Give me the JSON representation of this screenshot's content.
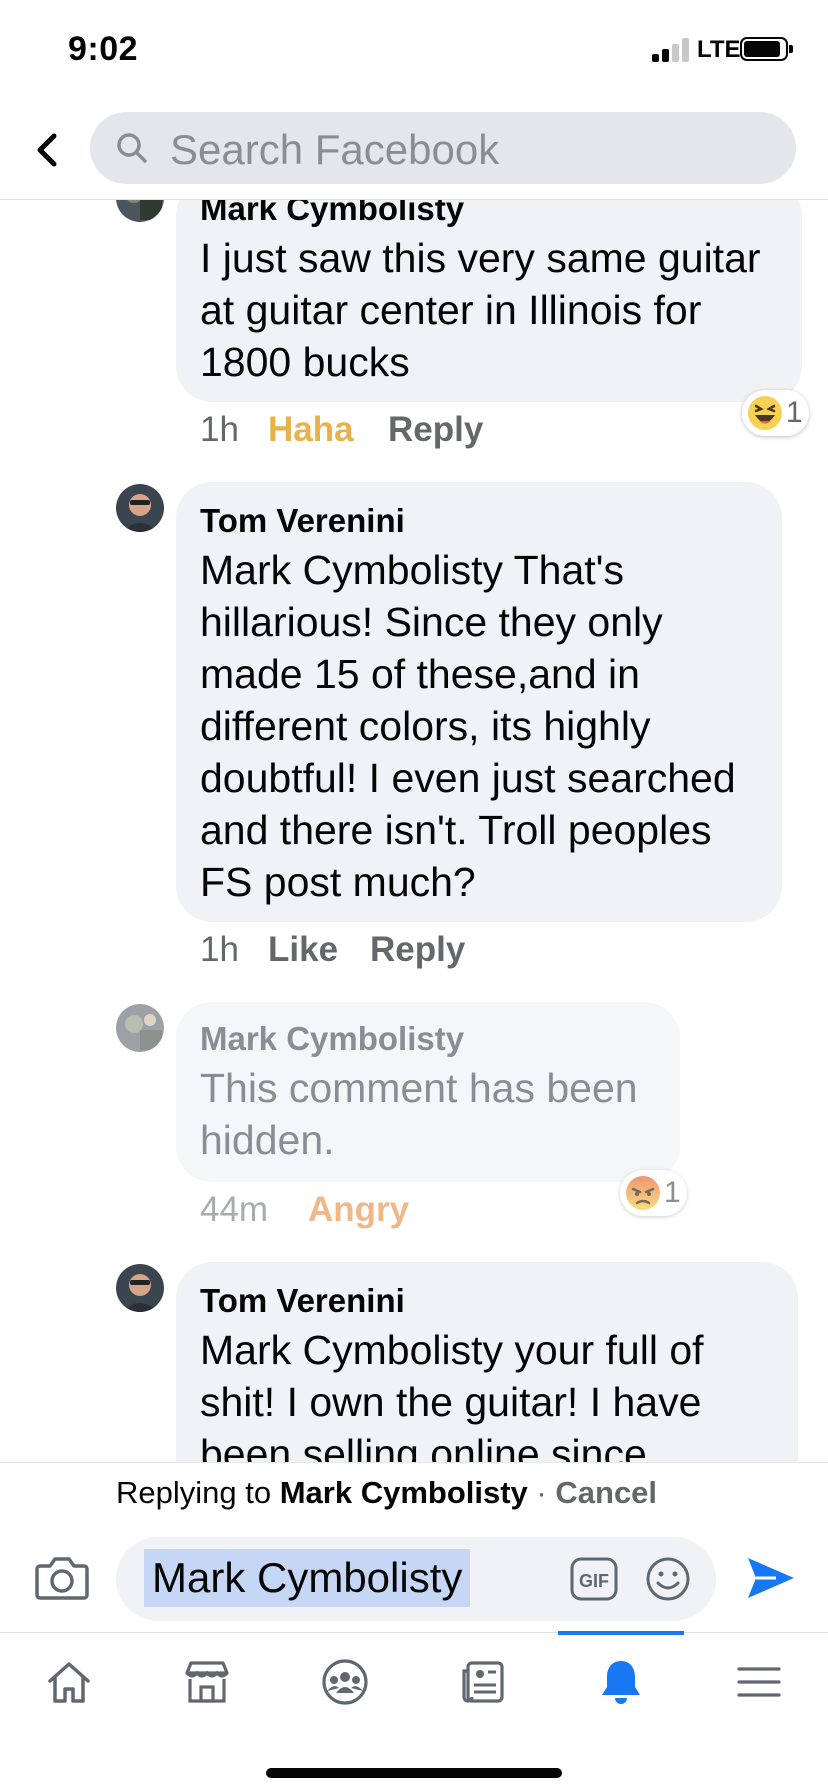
{
  "status_bar": {
    "time": "9:02",
    "network": "LTE"
  },
  "search": {
    "placeholder": "Search Facebook"
  },
  "comments": [
    {
      "author": "Mark Cymbolisty",
      "text": "I just saw this very same guitar at guitar center in Illinois for 1800 bucks",
      "time": "1h",
      "action_1": "Haha",
      "action_2": "Reply",
      "reaction": {
        "icon": "haha-icon",
        "count": "1"
      }
    },
    {
      "author": "Tom Verenini",
      "text": "Mark Cymbolisty That's hillarious! Since they only made 15 of these,and in different colors, its highly doubtful! I even just searched and there isn't. Troll peoples FS post much?",
      "time": "1h",
      "action_1": "Like",
      "action_2": "Reply"
    },
    {
      "author": "Mark Cymbolisty",
      "text": "This comment has been hidden.",
      "time": "44m",
      "action_1": "Angry",
      "reaction": {
        "icon": "angry-icon",
        "count": "1"
      },
      "hidden": true
    },
    {
      "author": "Tom Verenini",
      "text": "Mark Cymbolisty your full of shit! I own the guitar! I have been selling online since"
    }
  ],
  "reply_bar": {
    "prefix": "Replying to",
    "name": "Mark Cymbolisty",
    "separator": "·",
    "cancel": "Cancel"
  },
  "composer": {
    "value": "Mark Cymbolisty",
    "gif_label": "GIF"
  },
  "tabs": [
    "home-icon",
    "marketplace-icon",
    "groups-icon",
    "news-icon",
    "notifications-icon",
    "menu-icon"
  ],
  "colors": {
    "accent": "#1877f2",
    "haha": "#e7b24a",
    "angry": "#f0b78a",
    "bubble": "#f0f2f5"
  }
}
